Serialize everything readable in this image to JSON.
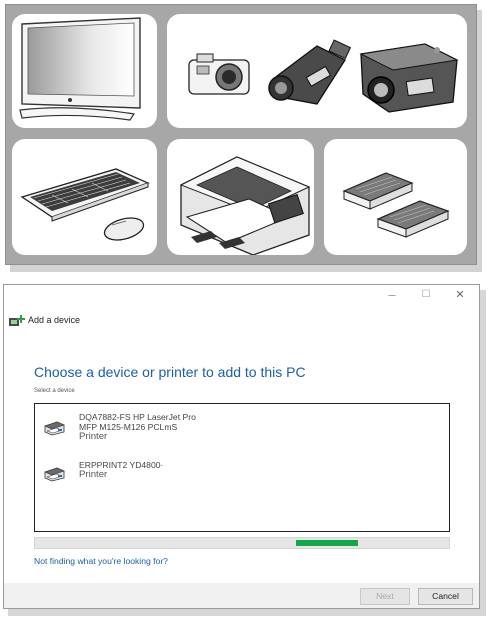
{
  "dialog": {
    "window_controls": {
      "minimize": "–",
      "maximize": "☐",
      "close": "✕"
    },
    "title": "Add a device",
    "heading": "Choose a device or printer to add to this PC",
    "subheading": "Select a device",
    "devices": [
      {
        "name_line1": "DQA7882-FS  HP LaserJet Pro",
        "name_line2": "MFP M125-M126 PCLmS",
        "type": "Printer",
        "icon": "printer-icon"
      },
      {
        "name_line1": "ERPPRINT2   YD4800·",
        "name_line2": "",
        "type": "Printer",
        "icon": "printer-icon"
      }
    ],
    "scan_progress": {
      "segment_start": 0.63,
      "segment_end": 0.78,
      "color": "#12a84a"
    },
    "help_link": "Not finding what you're looking for?",
    "buttons": {
      "next": "Next",
      "cancel": "Cancel"
    }
  },
  "device_panel": {
    "background_color": "#a7a7a7",
    "tiles": [
      {
        "icon": "monitor-icon"
      },
      {
        "icons": [
          "digital-camera-icon",
          "camcorder-icon",
          "projector-icon"
        ]
      },
      {
        "icons": [
          "keyboard-icon",
          "mouse-icon"
        ]
      },
      {
        "icon": "printer-icon"
      },
      {
        "icons": [
          "external-drive-icon",
          "external-drive-icon"
        ]
      }
    ]
  },
  "colors": {
    "accent": "#1a5fa8",
    "progress": "#12a84a"
  }
}
